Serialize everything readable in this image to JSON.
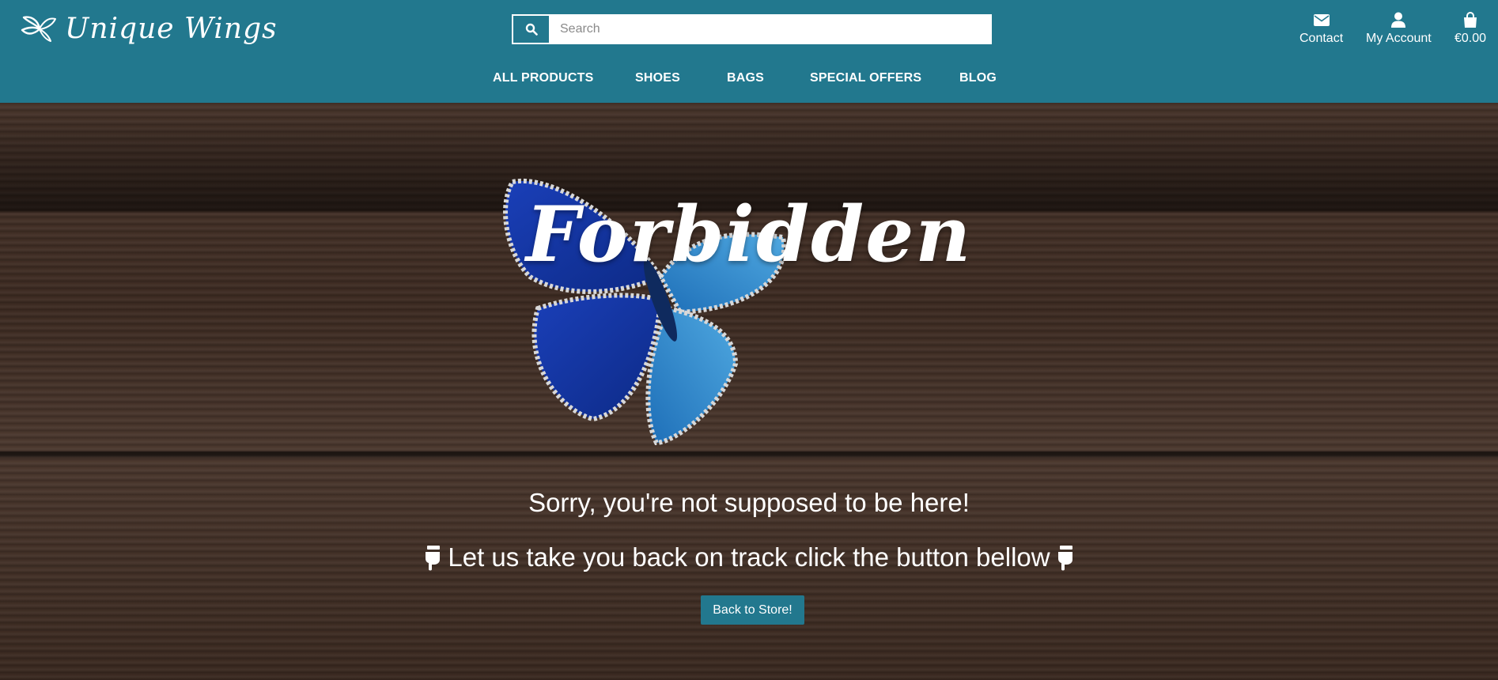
{
  "brand": {
    "name": "Unique Wings"
  },
  "search": {
    "placeholder": "Search"
  },
  "header_links": {
    "contact": "Contact",
    "account": "My Account",
    "cart_total": "€0.00"
  },
  "nav": {
    "all_products": "ALL PRODUCTS",
    "shoes": "SHOES",
    "bags": "BAGS",
    "special_offers": "SPECIAL OFFERS",
    "blog": "BLOG"
  },
  "hero": {
    "title": "Forbidden",
    "message": "Sorry, you're not supposed to be here!",
    "track_message": "Let us take you back on track click the button bellow",
    "button_label": "Back to Store!"
  },
  "colors": {
    "brand_teal": "#22788e",
    "wood_dark": "#3d2b22",
    "text": "#ffffff"
  },
  "icons": [
    "butterfly-logo-icon",
    "search-icon",
    "envelope-icon",
    "user-icon",
    "shopping-bag-icon",
    "hand-pointing-down-icon"
  ]
}
